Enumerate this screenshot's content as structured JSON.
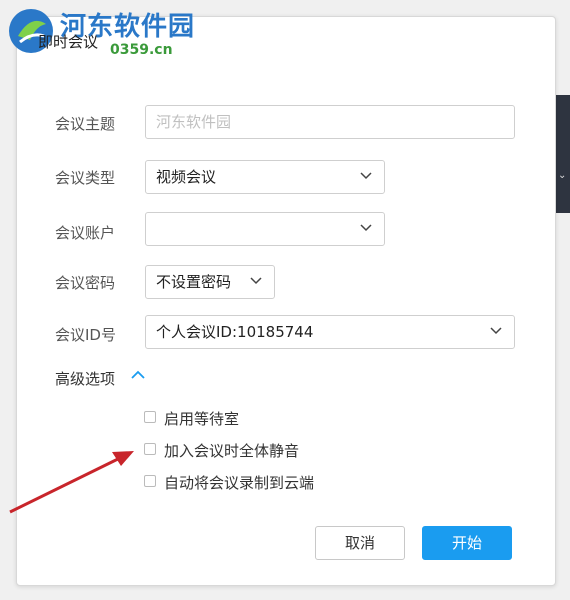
{
  "watermark": {
    "name": "河东软件园",
    "url": "0359.cn"
  },
  "dialog": {
    "title": "即时会议",
    "topic": {
      "label": "会议主题",
      "placeholder": "河东软件园"
    },
    "type": {
      "label": "会议类型",
      "value": "视频会议"
    },
    "account": {
      "label": "会议账户",
      "value": ""
    },
    "password": {
      "label": "会议密码",
      "value": "不设置密码"
    },
    "meeting_id": {
      "label": "会议ID号",
      "value": "个人会议ID:10185744"
    },
    "advanced": {
      "label": "高级选项",
      "options": [
        {
          "label": "启用等待室",
          "checked": false
        },
        {
          "label": "加入会议时全体静音",
          "checked": false
        },
        {
          "label": "自动将会议录制到云端",
          "checked": false
        }
      ]
    },
    "cancel_label": "取消",
    "start_label": "开始"
  },
  "colors": {
    "primary": "#1a9cf0",
    "annotation_arrow": "#c8252b"
  }
}
